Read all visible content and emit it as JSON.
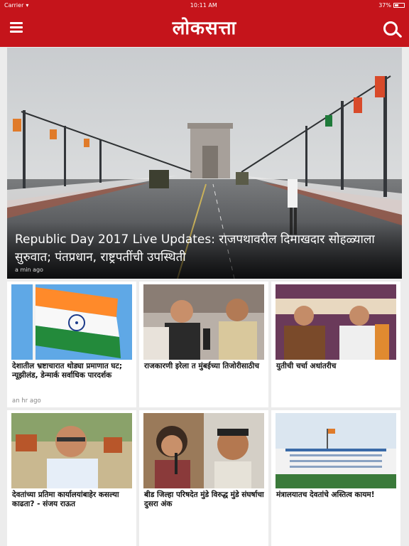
{
  "status_bar": {
    "carrier": "Carrier",
    "time": "10:11 AM",
    "battery": "37%"
  },
  "header": {
    "logo_text": "लोकसत्ता"
  },
  "hero": {
    "title": "Republic Day 2017 Live Updates: राजपथावरील दिमाखदार सोहळ्याला सुरुवात; पंतप्रधान, राष्ट्रपतींची उपस्थिती",
    "time": "a min ago"
  },
  "articles": [
    {
      "headline": "देशातील भ्रष्टाचारात थोड्या प्रमाणात घट; न्यूझीलंड, डेन्मार्क सर्वाधिक पारदर्शक",
      "time": "an hr ago"
    },
    {
      "headline": "राजकारणी इरेला त मुंबईच्या तिजोरीसाठीच",
      "time": ""
    },
    {
      "headline": "युतीची चर्चा अधांतरीच",
      "time": ""
    },
    {
      "headline": "देवतांच्या प्रतिमा कार्यालयांबाहेर कसल्या काढता? - संजय राऊत",
      "time": ""
    },
    {
      "headline": "बीड जिल्हा परिषदेत मुंडे विरुद्ध मुंडे संघर्षाचा दुसरा अंक",
      "time": ""
    },
    {
      "headline": "मंत्रालयातच देवतांचे अस्तित्व कायम!",
      "time": ""
    }
  ],
  "colors": {
    "brand": "#c5141b"
  }
}
